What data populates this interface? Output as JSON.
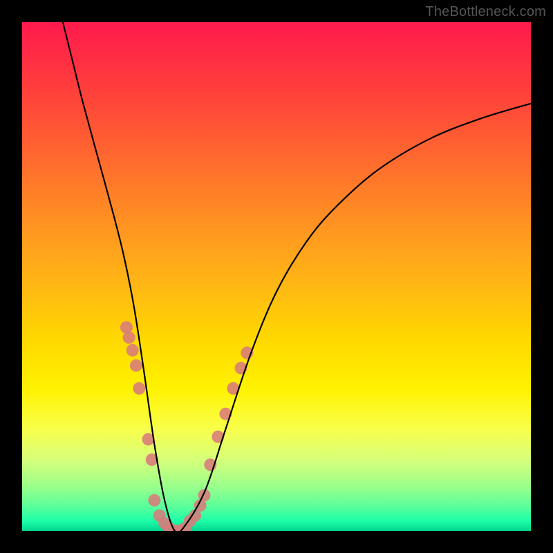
{
  "attribution": "TheBottleneck.com",
  "chart_data": {
    "type": "line",
    "title": "",
    "xlabel": "",
    "ylabel": "",
    "xlim": [
      0,
      100
    ],
    "ylim": [
      0,
      100
    ],
    "gradient_stops": [
      {
        "pos": 0,
        "color": "#ff1a4d"
      },
      {
        "pos": 12,
        "color": "#ff3b3d"
      },
      {
        "pos": 22,
        "color": "#ff5a33"
      },
      {
        "pos": 32,
        "color": "#ff7a29"
      },
      {
        "pos": 42,
        "color": "#ff9a1f"
      },
      {
        "pos": 52,
        "color": "#ffb814"
      },
      {
        "pos": 62,
        "color": "#ffd700"
      },
      {
        "pos": 72,
        "color": "#fff200"
      },
      {
        "pos": 80,
        "color": "#f8ff4a"
      },
      {
        "pos": 86,
        "color": "#d6ff7a"
      },
      {
        "pos": 91,
        "color": "#9eff8a"
      },
      {
        "pos": 95,
        "color": "#5eff9a"
      },
      {
        "pos": 98,
        "color": "#1effa8"
      },
      {
        "pos": 100,
        "color": "#00d68f"
      }
    ],
    "series": [
      {
        "name": "bottleneck-curve",
        "x": [
          8,
          10,
          12,
          15,
          18,
          20,
          22,
          24,
          26,
          28,
          30,
          32,
          36,
          40,
          45,
          50,
          56,
          62,
          70,
          80,
          90,
          100
        ],
        "y": [
          100,
          92,
          84,
          73,
          62,
          54,
          44,
          31,
          17,
          6,
          0,
          1,
          8,
          20,
          35,
          47,
          57,
          64,
          71,
          77,
          81,
          84
        ]
      }
    ],
    "markers": {
      "name": "highlight-points",
      "color": "#d87b7b",
      "radius_px": 9,
      "points": [
        {
          "x": 20.5,
          "y": 40.0
        },
        {
          "x": 21.0,
          "y": 38.0
        },
        {
          "x": 21.7,
          "y": 35.5
        },
        {
          "x": 22.4,
          "y": 32.5
        },
        {
          "x": 23.0,
          "y": 28.0
        },
        {
          "x": 24.8,
          "y": 18.0
        },
        {
          "x": 25.5,
          "y": 14.0
        },
        {
          "x": 26.0,
          "y": 6.0
        },
        {
          "x": 27.0,
          "y": 3.0
        },
        {
          "x": 28.0,
          "y": 1.5
        },
        {
          "x": 29.0,
          "y": 0.5
        },
        {
          "x": 30.0,
          "y": 0.0
        },
        {
          "x": 31.0,
          "y": 0.0
        },
        {
          "x": 32.0,
          "y": 0.5
        },
        {
          "x": 33.0,
          "y": 2.0
        },
        {
          "x": 34.0,
          "y": 3.0
        },
        {
          "x": 35.0,
          "y": 5.0
        },
        {
          "x": 35.8,
          "y": 7.0
        },
        {
          "x": 37.0,
          "y": 13.0
        },
        {
          "x": 38.5,
          "y": 18.5
        },
        {
          "x": 40.0,
          "y": 23.0
        },
        {
          "x": 41.5,
          "y": 28.0
        },
        {
          "x": 43.0,
          "y": 32.0
        },
        {
          "x": 44.2,
          "y": 35.0
        }
      ]
    }
  }
}
